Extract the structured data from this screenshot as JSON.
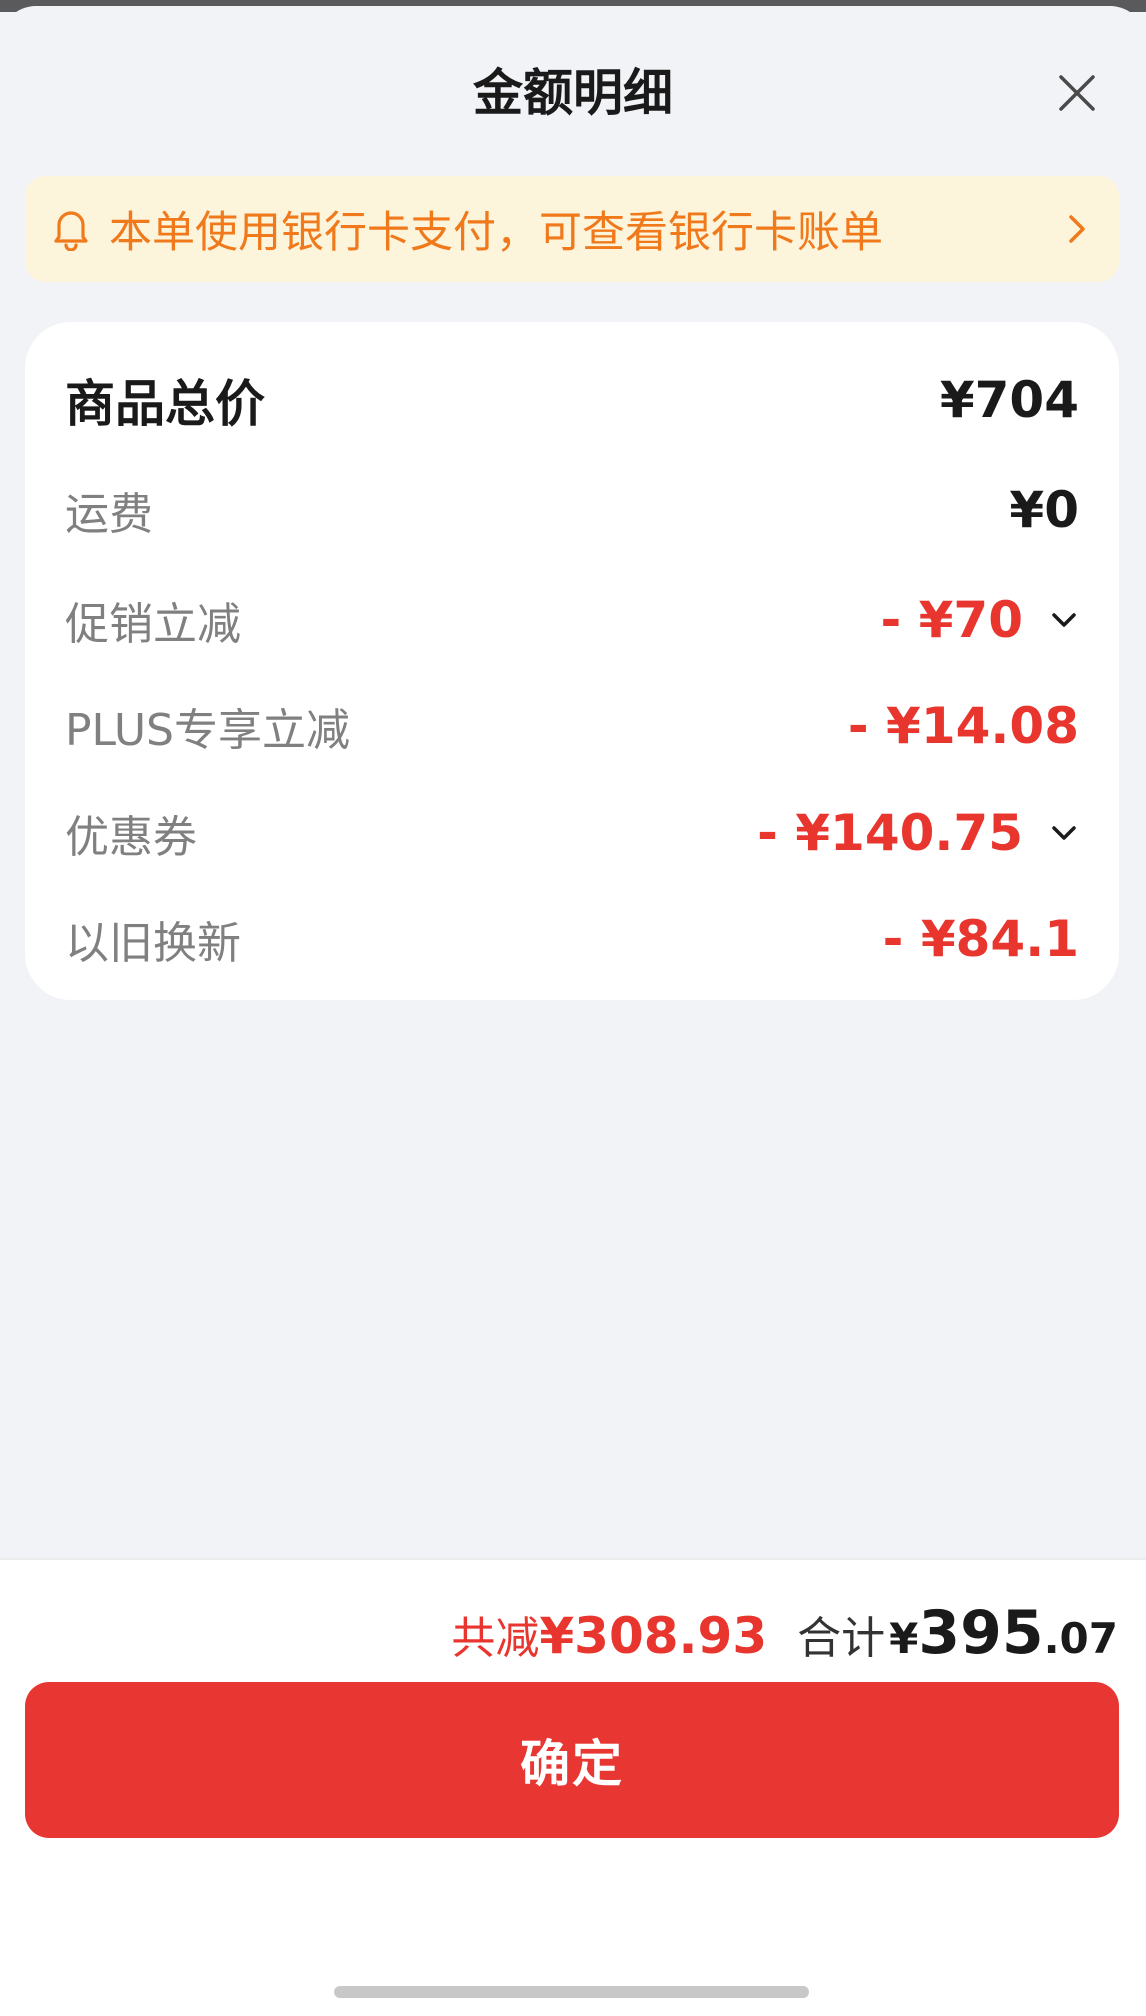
{
  "sheet": {
    "title": "金额明细"
  },
  "notice": {
    "text": "本单使用银行卡支付，可查看银行卡账单"
  },
  "details": {
    "subtotal": {
      "label": "商品总价",
      "value": "¥704"
    },
    "shipping": {
      "label": "运费",
      "value": "¥0"
    },
    "promo": {
      "label": "促销立减",
      "value": "- ¥70"
    },
    "plus": {
      "label": "PLUS专享立减",
      "value": "- ¥14.08"
    },
    "coupon": {
      "label": "优惠券",
      "value": "- ¥140.75"
    },
    "tradein": {
      "label": "以旧换新",
      "value": "- ¥84.1"
    }
  },
  "footer": {
    "saved_label": "共减",
    "saved_amount": "¥308.93",
    "total_label": "合计",
    "total_currency": "¥",
    "total_integer": "395",
    "total_decimal": ".07",
    "confirm_label": "确定"
  },
  "colors": {
    "accent_red": "#e83632",
    "notice_orange": "#f07a1b",
    "notice_bg": "#fdf4dc"
  },
  "icons": {
    "close": "close-icon",
    "bell": "bell-icon",
    "chevron": "chevron-right-icon",
    "caret": "chevron-down-icon"
  }
}
